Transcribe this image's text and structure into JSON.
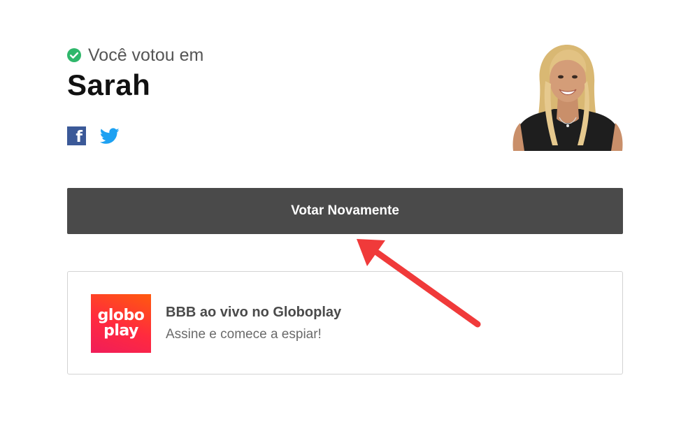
{
  "vote": {
    "confirmation_label": "Você votou em",
    "candidate_name": "Sarah"
  },
  "share": {
    "facebook_glyph": "f",
    "icons": [
      "facebook-icon",
      "twitter-icon"
    ]
  },
  "actions": {
    "vote_again_label": "Votar Novamente"
  },
  "promo": {
    "logo_line1": "globo",
    "logo_line2": "play",
    "title": "BBB ao vivo no Globoplay",
    "subtitle": "Assine e comece a espiar!"
  },
  "colors": {
    "check": "#2fb76b",
    "button": "#4a4a4a",
    "facebook": "#3b5998",
    "twitter": "#1da1f2",
    "annotation_arrow": "#f03a3a"
  }
}
